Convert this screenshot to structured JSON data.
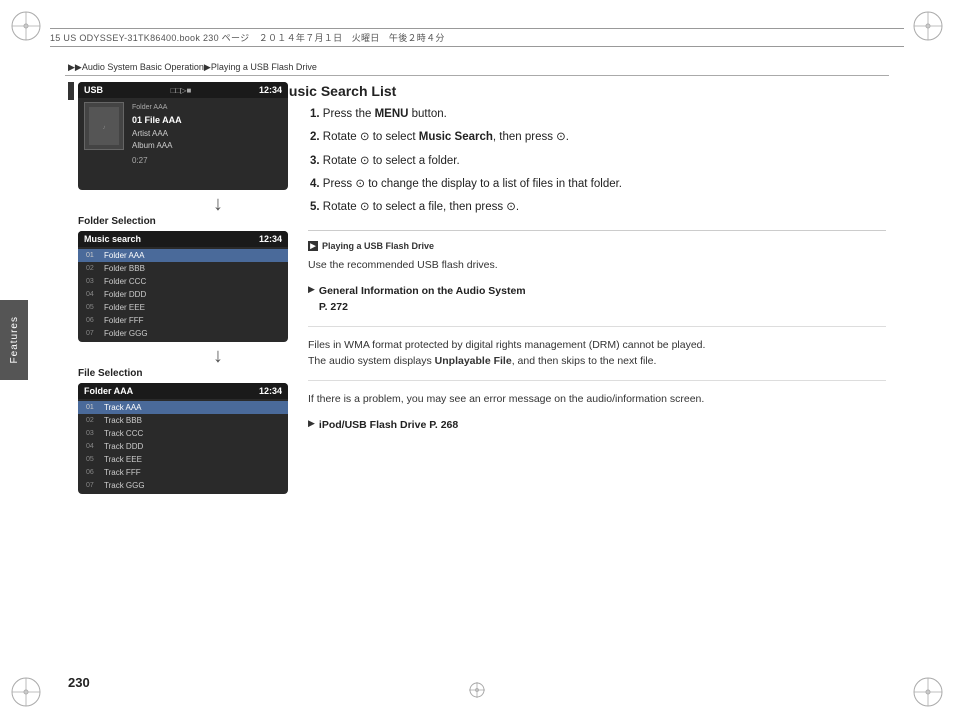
{
  "page": {
    "number": "230",
    "header_text": "15 US ODYSSEY-31TK86400.book  230 ページ　２０１４年７月１日　火曜日　午後２時４分"
  },
  "breadcrumb": {
    "text": "▶▶Audio System Basic Operation▶Playing a USB Flash Drive"
  },
  "section": {
    "heading": "How to Select a File from the Music Search List"
  },
  "steps": [
    {
      "num": "1.",
      "text": "Press the MENU button."
    },
    {
      "num": "2.",
      "text": "Rotate ⊙ to select Music Search, then press ⊙."
    },
    {
      "num": "3.",
      "text": "Rotate ⊙ to select a folder."
    },
    {
      "num": "4.",
      "text": "Press ⊙ to change the display to a list of files in that folder."
    },
    {
      "num": "5.",
      "text": "Rotate ⊙ to select a file, then press ⊙."
    }
  ],
  "usb_screen": {
    "title": "USB",
    "icons": "□□▷■",
    "time": "12:34",
    "folder_line": "Folder AAA",
    "file_line": "01 File AAA",
    "artist": "Artist AAA",
    "album": "Album AAA",
    "time_display": "0:27"
  },
  "folder_selection": {
    "label": "Folder Selection",
    "title": "Music search",
    "time": "12:34",
    "items": [
      {
        "num": "01",
        "name": "Folder AAA",
        "selected": true
      },
      {
        "num": "02",
        "name": "Folder BBB",
        "selected": false
      },
      {
        "num": "03",
        "name": "Folder CCC",
        "selected": false
      },
      {
        "num": "04",
        "name": "Folder DDD",
        "selected": false
      },
      {
        "num": "05",
        "name": "Folder EEE",
        "selected": false
      },
      {
        "num": "06",
        "name": "Folder FFF",
        "selected": false
      },
      {
        "num": "07",
        "name": "Folder GGG",
        "selected": false
      }
    ]
  },
  "file_selection": {
    "label": "File Selection",
    "title": "Folder AAA",
    "time": "12:34",
    "items": [
      {
        "num": "01",
        "name": "Track AAA",
        "selected": true
      },
      {
        "num": "02",
        "name": "Track BBB",
        "selected": false
      },
      {
        "num": "03",
        "name": "Track CCC",
        "selected": false
      },
      {
        "num": "04",
        "name": "Track DDD",
        "selected": false
      },
      {
        "num": "05",
        "name": "Track EEE",
        "selected": false
      },
      {
        "num": "06",
        "name": "Track FFF",
        "selected": false
      },
      {
        "num": "07",
        "name": "Track GGG",
        "selected": false
      }
    ]
  },
  "sidebar": {
    "label": "Features"
  },
  "right_panel": {
    "note_header": "▶Playing a USB Flash Drive",
    "note_body": "Use the recommended USB flash drives.",
    "link1_label": "General Information on the Audio System",
    "link1_ref": "P. 272",
    "para2": "Files in WMA format protected by digital rights management (DRM) cannot be played.\nThe audio system displays Unplayable File, and then skips to the next file.",
    "para3": "If there is a problem, you may see an error message on the audio/information screen.",
    "link2_label": "iPod/USB Flash Drive",
    "link2_ref": "P. 268"
  },
  "features_label": "Features"
}
